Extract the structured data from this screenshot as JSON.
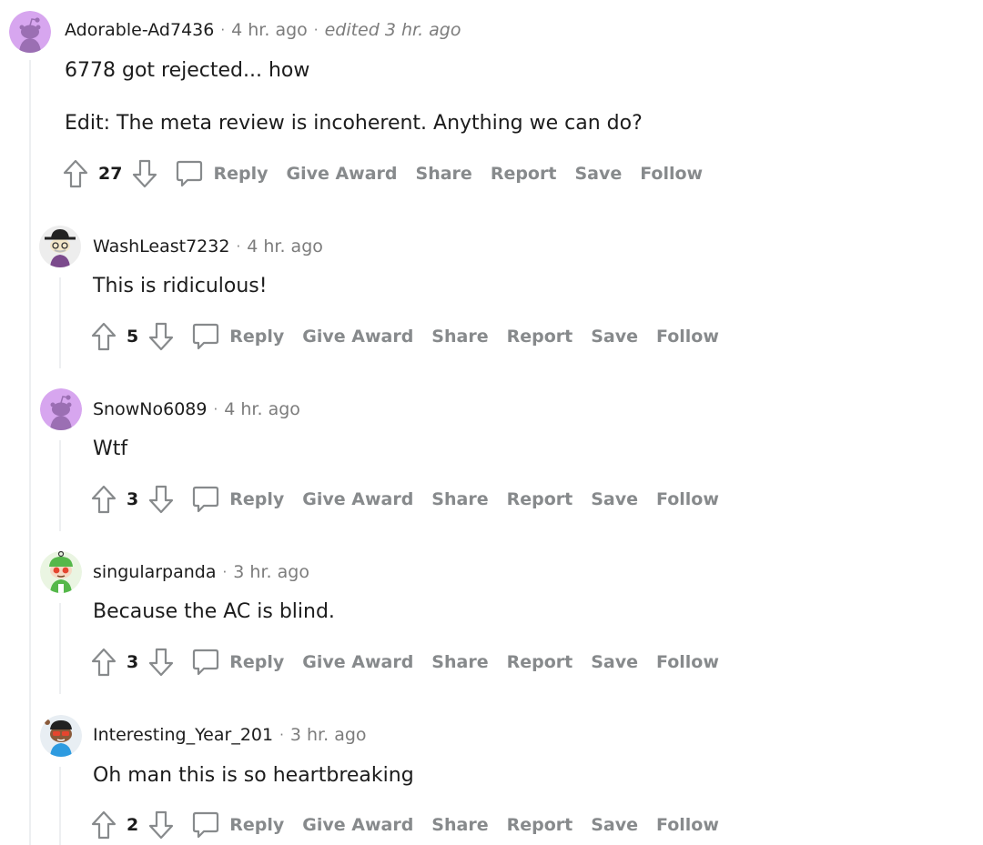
{
  "comments": [
    {
      "author": "Adorable-Ad7436",
      "time": "4 hr. ago",
      "edited": "edited 3 hr. ago",
      "body": [
        "6778 got rejected... how",
        "Edit: The meta review is incoherent. Anything we can do?"
      ],
      "score": "27",
      "avatar": "snoo-purple"
    },
    {
      "author": "WashLeast7232",
      "time": "4 hr. ago",
      "body": [
        "This is ridiculous!"
      ],
      "score": "5",
      "avatar": "snoo-hat-glasses"
    },
    {
      "author": "SnowNo6089",
      "time": "4 hr. ago",
      "body": [
        "Wtf"
      ],
      "score": "3",
      "avatar": "snoo-purple"
    },
    {
      "author": "singularpanda",
      "time": "3 hr. ago",
      "body": [
        "Because the AC is blind."
      ],
      "score": "3",
      "avatar": "snoo-green"
    },
    {
      "author": "Interesting_Year_201",
      "time": "3 hr. ago",
      "body": [
        "Oh man this is so heartbreaking"
      ],
      "score": "2",
      "avatar": "snoo-blue-sunglasses"
    }
  ],
  "actions": {
    "reply": "Reply",
    "give_award": "Give Award",
    "share": "Share",
    "report": "Report",
    "save": "Save",
    "follow": "Follow"
  },
  "colors": {
    "muted": "#878a8c",
    "thread_line": "#edeff1",
    "snoo_purple": "#d7a6ef"
  }
}
